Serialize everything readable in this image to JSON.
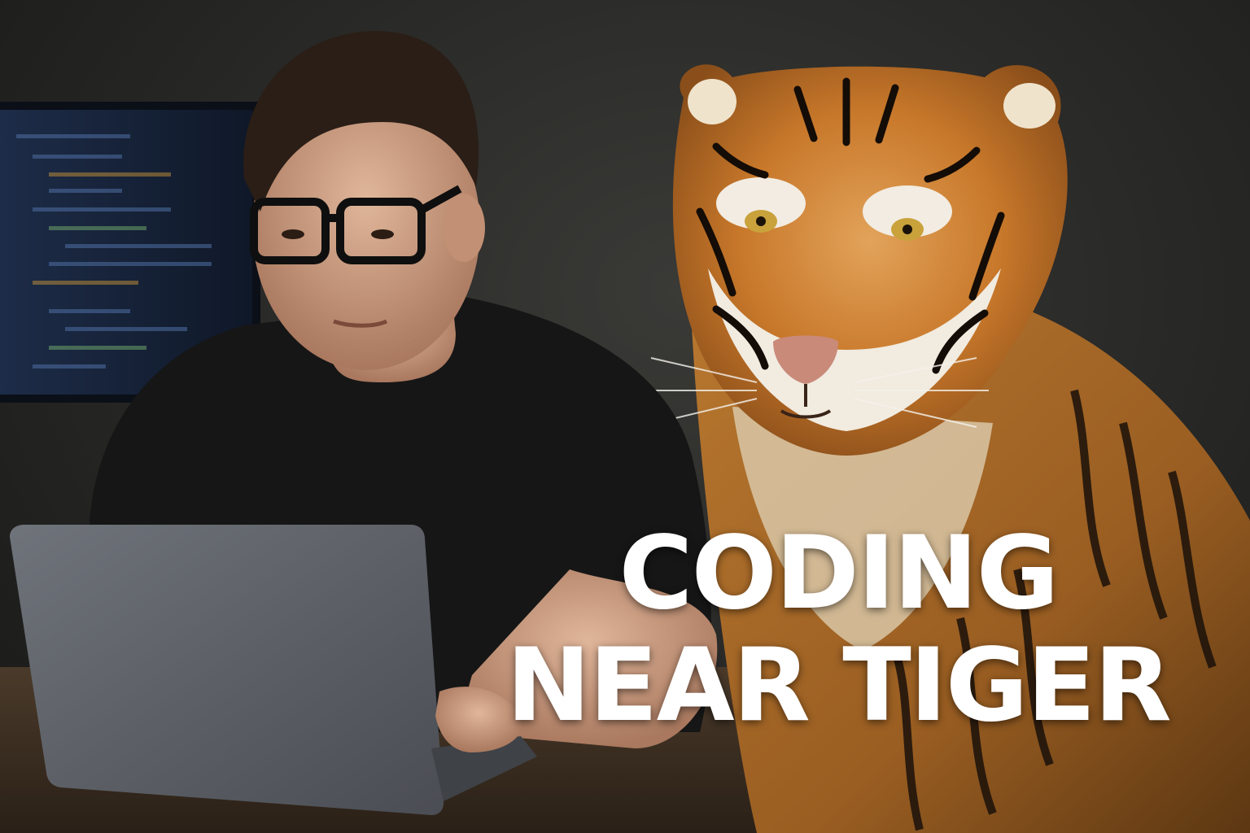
{
  "image": {
    "description_icon": "photo-scene",
    "headline": {
      "line1": "CODING",
      "line2": "NEAR TIGER"
    },
    "colors": {
      "headline_text": "#ffffff",
      "background_wall": "#2a2a28",
      "tiger_orange": "#c8782a",
      "shirt": "#161616",
      "laptop": "#5d6168",
      "monitor_code": "#1b2a44"
    }
  }
}
